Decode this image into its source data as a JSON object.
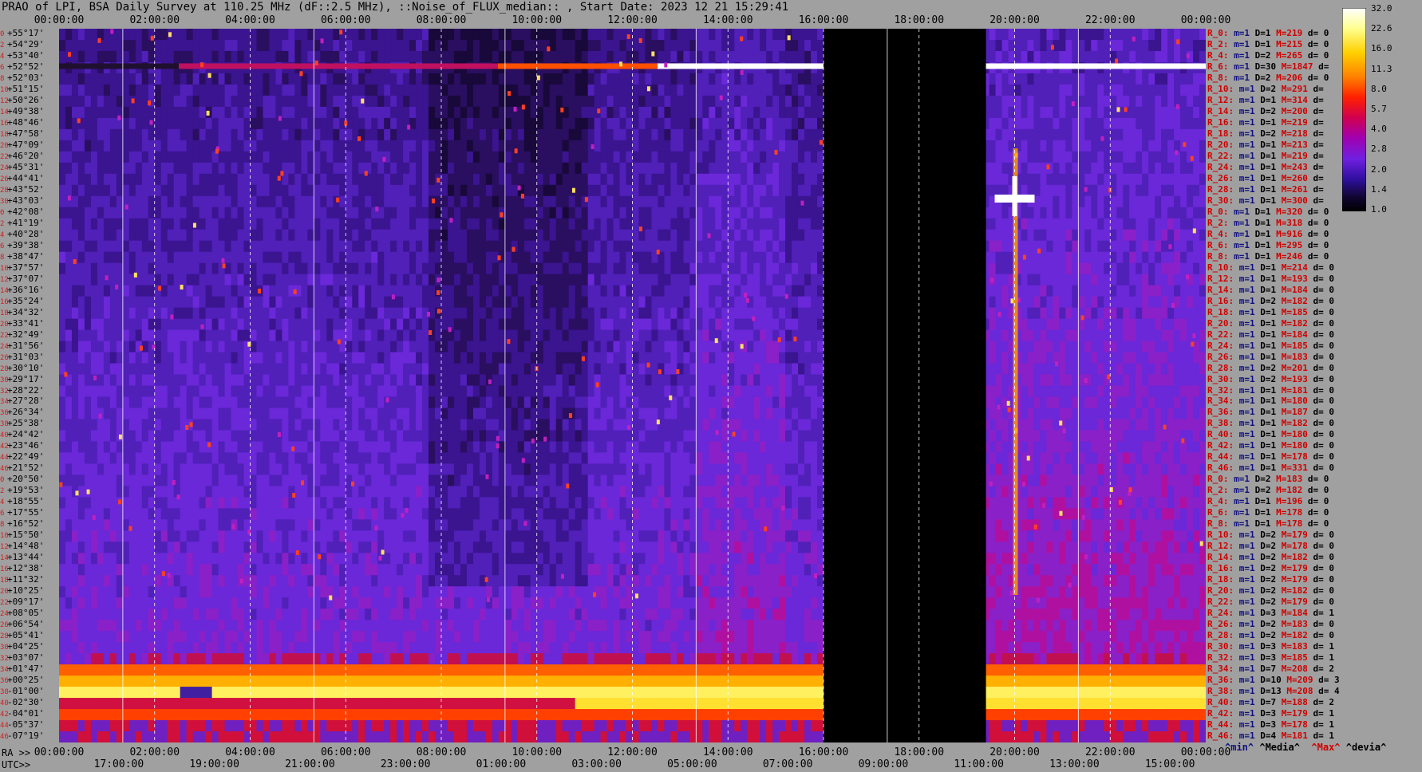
{
  "title": "PRAO of LPI, BSA Daily Survey at 110.25 MHz (dF::2.5 MHz), ::Noise_of_FLUX_median:: , Start Date: 2023 12 21 15:29:41",
  "ra_prefix": "RA >>",
  "utc_prefix": "UTC>>",
  "legend": {
    "min": "^min^",
    "media": "^Media^",
    "max": "^Max^",
    "devia": "^devia^"
  },
  "colors": {
    "background": "#a0a0a0",
    "index": "#d02020",
    "min": "#101080",
    "max": "#d00000"
  },
  "chart_data": {
    "type": "heatmap",
    "x_axis_top": [
      "00:00:00",
      "02:00:00",
      "04:00:00",
      "06:00:00",
      "08:00:00",
      "10:00:00",
      "12:00:00",
      "14:00:00",
      "16:00:00",
      "18:00:00",
      "20:00:00",
      "22:00:00",
      "00:00:00"
    ],
    "x_axis_ra": [
      "00:00:00",
      "02:00:00",
      "04:00:00",
      "06:00:00",
      "08:00:00",
      "10:00:00",
      "12:00:00",
      "14:00:00",
      "16:00:00",
      "18:00:00",
      "20:00:00",
      "22:00:00",
      "00:00:00"
    ],
    "x_axis_utc": [
      "17:00:00",
      "19:00:00",
      "21:00:00",
      "23:00:00",
      "01:00:00",
      "03:00:00",
      "05:00:00",
      "07:00:00",
      "09:00:00",
      "11:00:00",
      "13:00:00",
      "15:00:00"
    ],
    "declinations": [
      "+55°17'",
      "+54°29'",
      "+53°40'",
      "+52°52'",
      "+52°03'",
      "+51°15'",
      "+50°26'",
      "+49°38'",
      "+48°46'",
      "+47°58'",
      "+47°09'",
      "+46°20'",
      "+45°31'",
      "+44°41'",
      "+43°52'",
      "+43°03'",
      "+42°08'",
      "+41°19'",
      "+40°28'",
      "+39°38'",
      "+38°47'",
      "+37°57'",
      "+37°07'",
      "+36°16'",
      "+35°24'",
      "+34°32'",
      "+33°41'",
      "+32°49'",
      "+31°56'",
      "+31°03'",
      "+30°10'",
      "+29°17'",
      "+28°22'",
      "+27°28'",
      "+26°34'",
      "+25°38'",
      "+24°42'",
      "+23°46'",
      "+22°49'",
      "+21°52'",
      "+20°50'",
      "+19°53'",
      "+18°55'",
      "+17°55'",
      "+16°52'",
      "+15°50'",
      "+14°48'",
      "+13°44'",
      "+12°38'",
      "+11°32'",
      "+10°25'",
      "+09°17'",
      "+08°05'",
      "+06°54'",
      "+05°41'",
      "+04°25'",
      "+03°07'",
      "+01°47'",
      "+00°25'",
      "-01°00'",
      "-02°30'",
      "-04°01'",
      "-05°37'",
      "-07°19'"
    ],
    "row_index": [
      "0",
      "2",
      "4",
      "6",
      "8",
      "10",
      "12",
      "14",
      "16",
      "18",
      "20",
      "22",
      "24",
      "26",
      "28",
      "30",
      "0",
      "2",
      "4",
      "6",
      "8",
      "10",
      "12",
      "14",
      "16",
      "18",
      "20",
      "22",
      "24",
      "26",
      "28",
      "30",
      "32",
      "34",
      "36",
      "38",
      "40",
      "42",
      "44",
      "46",
      "0",
      "2",
      "4",
      "6",
      "8",
      "10",
      "12",
      "14",
      "16",
      "18",
      "20",
      "22",
      "24",
      "26",
      "28",
      "30",
      "32",
      "34",
      "36",
      "38",
      "40",
      "42",
      "44",
      "46"
    ],
    "row_stats": [
      {
        "r": "R_0:",
        "m": "m=1",
        "d": "D=1",
        "x": "M=219",
        "dev": "d= 0"
      },
      {
        "r": "R_2:",
        "m": "m=1",
        "d": "D=1",
        "x": "M=215",
        "dev": "d= 0"
      },
      {
        "r": "R_4:",
        "m": "m=1",
        "d": "D=2",
        "x": "M=265",
        "dev": "d= 0"
      },
      {
        "r": "R_6:",
        "m": "m=1",
        "d": "D=30",
        "x": "M=1847",
        "dev": "d="
      },
      {
        "r": "R_8:",
        "m": "m=1",
        "d": "D=2",
        "x": "M=206",
        "dev": "d= 0"
      },
      {
        "r": "R_10:",
        "m": "m=1",
        "d": "D=2",
        "x": "M=291",
        "dev": "d="
      },
      {
        "r": "R_12:",
        "m": "m=1",
        "d": "D=1",
        "x": "M=314",
        "dev": "d="
      },
      {
        "r": "R_14:",
        "m": "m=1",
        "d": "D=2",
        "x": "M=200",
        "dev": "d="
      },
      {
        "r": "R_16:",
        "m": "m=1",
        "d": "D=1",
        "x": "M=219",
        "dev": "d="
      },
      {
        "r": "R_18:",
        "m": "m=1",
        "d": "D=2",
        "x": "M=218",
        "dev": "d="
      },
      {
        "r": "R_20:",
        "m": "m=1",
        "d": "D=1",
        "x": "M=213",
        "dev": "d="
      },
      {
        "r": "R_22:",
        "m": "m=1",
        "d": "D=1",
        "x": "M=219",
        "dev": "d="
      },
      {
        "r": "R_24:",
        "m": "m=1",
        "d": "D=1",
        "x": "M=243",
        "dev": "d="
      },
      {
        "r": "R_26:",
        "m": "m=1",
        "d": "D=1",
        "x": "M=260",
        "dev": "d="
      },
      {
        "r": "R_28:",
        "m": "m=1",
        "d": "D=1",
        "x": "M=261",
        "dev": "d="
      },
      {
        "r": "R_30:",
        "m": "m=1",
        "d": "D=1",
        "x": "M=300",
        "dev": "d="
      },
      {
        "r": "R_0:",
        "m": "m=1",
        "d": "D=1",
        "x": "M=320",
        "dev": "d= 0"
      },
      {
        "r": "R_2:",
        "m": "m=1",
        "d": "D=1",
        "x": "M=318",
        "dev": "d= 0"
      },
      {
        "r": "R_4:",
        "m": "m=1",
        "d": "D=1",
        "x": "M=916",
        "dev": "d= 0"
      },
      {
        "r": "R_6:",
        "m": "m=1",
        "d": "D=1",
        "x": "M=295",
        "dev": "d= 0"
      },
      {
        "r": "R_8:",
        "m": "m=1",
        "d": "D=1",
        "x": "M=246",
        "dev": "d= 0"
      },
      {
        "r": "R_10:",
        "m": "m=1",
        "d": "D=1",
        "x": "M=214",
        "dev": "d= 0"
      },
      {
        "r": "R_12:",
        "m": "m=1",
        "d": "D=1",
        "x": "M=193",
        "dev": "d= 0"
      },
      {
        "r": "R_14:",
        "m": "m=1",
        "d": "D=1",
        "x": "M=184",
        "dev": "d= 0"
      },
      {
        "r": "R_16:",
        "m": "m=1",
        "d": "D=2",
        "x": "M=182",
        "dev": "d= 0"
      },
      {
        "r": "R_18:",
        "m": "m=1",
        "d": "D=1",
        "x": "M=185",
        "dev": "d= 0"
      },
      {
        "r": "R_20:",
        "m": "m=1",
        "d": "D=1",
        "x": "M=182",
        "dev": "d= 0"
      },
      {
        "r": "R_22:",
        "m": "m=1",
        "d": "D=1",
        "x": "M=184",
        "dev": "d= 0"
      },
      {
        "r": "R_24:",
        "m": "m=1",
        "d": "D=1",
        "x": "M=185",
        "dev": "d= 0"
      },
      {
        "r": "R_26:",
        "m": "m=1",
        "d": "D=1",
        "x": "M=183",
        "dev": "d= 0"
      },
      {
        "r": "R_28:",
        "m": "m=1",
        "d": "D=2",
        "x": "M=201",
        "dev": "d= 0"
      },
      {
        "r": "R_30:",
        "m": "m=1",
        "d": "D=2",
        "x": "M=193",
        "dev": "d= 0"
      },
      {
        "r": "R_32:",
        "m": "m=1",
        "d": "D=1",
        "x": "M=181",
        "dev": "d= 0"
      },
      {
        "r": "R_34:",
        "m": "m=1",
        "d": "D=1",
        "x": "M=180",
        "dev": "d= 0"
      },
      {
        "r": "R_36:",
        "m": "m=1",
        "d": "D=1",
        "x": "M=187",
        "dev": "d= 0"
      },
      {
        "r": "R_38:",
        "m": "m=1",
        "d": "D=1",
        "x": "M=182",
        "dev": "d= 0"
      },
      {
        "r": "R_40:",
        "m": "m=1",
        "d": "D=1",
        "x": "M=180",
        "dev": "d= 0"
      },
      {
        "r": "R_42:",
        "m": "m=1",
        "d": "D=1",
        "x": "M=180",
        "dev": "d= 0"
      },
      {
        "r": "R_44:",
        "m": "m=1",
        "d": "D=1",
        "x": "M=178",
        "dev": "d= 0"
      },
      {
        "r": "R_46:",
        "m": "m=1",
        "d": "D=1",
        "x": "M=331",
        "dev": "d= 0"
      },
      {
        "r": "R_0:",
        "m": "m=1",
        "d": "D=2",
        "x": "M=183",
        "dev": "d= 0"
      },
      {
        "r": "R_2:",
        "m": "m=1",
        "d": "D=2",
        "x": "M=182",
        "dev": "d= 0"
      },
      {
        "r": "R_4:",
        "m": "m=1",
        "d": "D=1",
        "x": "M=196",
        "dev": "d= 0"
      },
      {
        "r": "R_6:",
        "m": "m=1",
        "d": "D=1",
        "x": "M=178",
        "dev": "d= 0"
      },
      {
        "r": "R_8:",
        "m": "m=1",
        "d": "D=1",
        "x": "M=178",
        "dev": "d= 0"
      },
      {
        "r": "R_10:",
        "m": "m=1",
        "d": "D=2",
        "x": "M=179",
        "dev": "d= 0"
      },
      {
        "r": "R_12:",
        "m": "m=1",
        "d": "D=2",
        "x": "M=178",
        "dev": "d= 0"
      },
      {
        "r": "R_14:",
        "m": "m=1",
        "d": "D=2",
        "x": "M=182",
        "dev": "d= 0"
      },
      {
        "r": "R_16:",
        "m": "m=1",
        "d": "D=2",
        "x": "M=179",
        "dev": "d= 0"
      },
      {
        "r": "R_18:",
        "m": "m=1",
        "d": "D=2",
        "x": "M=179",
        "dev": "d= 0"
      },
      {
        "r": "R_20:",
        "m": "m=1",
        "d": "D=2",
        "x": "M=182",
        "dev": "d= 0"
      },
      {
        "r": "R_22:",
        "m": "m=1",
        "d": "D=2",
        "x": "M=179",
        "dev": "d= 0"
      },
      {
        "r": "R_24:",
        "m": "m=1",
        "d": "D=3",
        "x": "M=184",
        "dev": "d= 1"
      },
      {
        "r": "R_26:",
        "m": "m=1",
        "d": "D=2",
        "x": "M=183",
        "dev": "d= 0"
      },
      {
        "r": "R_28:",
        "m": "m=1",
        "d": "D=2",
        "x": "M=182",
        "dev": "d= 0"
      },
      {
        "r": "R_30:",
        "m": "m=1",
        "d": "D=3",
        "x": "M=183",
        "dev": "d= 1"
      },
      {
        "r": "R_32:",
        "m": "m=1",
        "d": "D=3",
        "x": "M=185",
        "dev": "d= 1"
      },
      {
        "r": "R_34:",
        "m": "m=1",
        "d": "D=7",
        "x": "M=208",
        "dev": "d= 2"
      },
      {
        "r": "R_36:",
        "m": "m=1",
        "d": "D=10",
        "x": "M=209",
        "dev": "d= 3"
      },
      {
        "r": "R_38:",
        "m": "m=1",
        "d": "D=13",
        "x": "M=208",
        "dev": "d= 4"
      },
      {
        "r": "R_40:",
        "m": "m=1",
        "d": "D=7",
        "x": "M=188",
        "dev": "d= 2"
      },
      {
        "r": "R_42:",
        "m": "m=1",
        "d": "D=3",
        "x": "M=179",
        "dev": "d= 1"
      },
      {
        "r": "R_44:",
        "m": "m=1",
        "d": "D=3",
        "x": "M=178",
        "dev": "d= 1"
      },
      {
        "r": "R_46:",
        "m": "m=1",
        "d": "D=4",
        "x": "M=181",
        "dev": "d= 1"
      }
    ],
    "colorbar_ticks": [
      "32.0",
      "22.6",
      "16.0",
      "11.3",
      "8.0",
      "5.7",
      "4.0",
      "2.8",
      "2.0",
      "1.4",
      "1.0"
    ],
    "colorbar_colors": [
      "#ffffff",
      "#ffff80",
      "#ffd000",
      "#ff8000",
      "#ff2000",
      "#d00040",
      "#a000a0",
      "#7020d0",
      "#4010a0",
      "#180840",
      "#000000"
    ]
  }
}
